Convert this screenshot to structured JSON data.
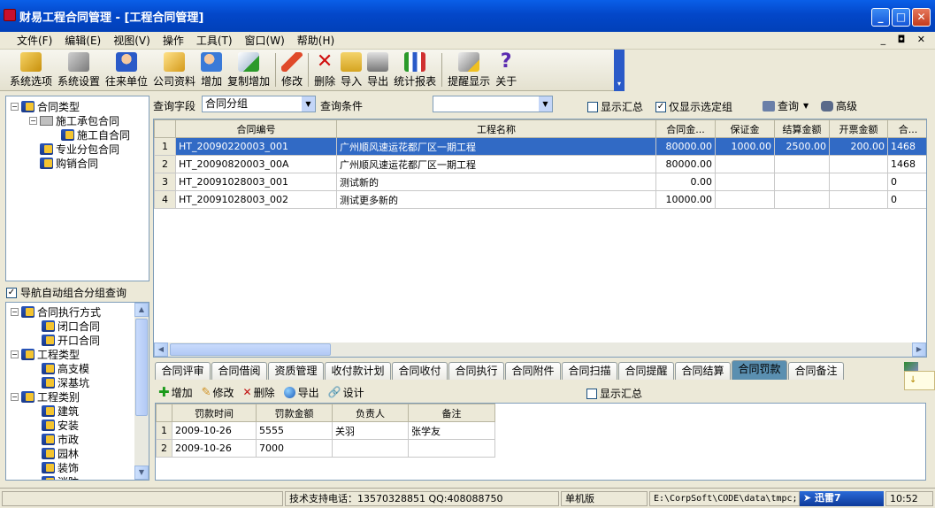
{
  "window": {
    "title": "财易工程合同管理 - [工程合同管理]"
  },
  "menu": [
    "文件(F)",
    "编辑(E)",
    "视图(V)",
    "操作",
    "工具(T)",
    "窗口(W)",
    "帮助(H)"
  ],
  "toolbar": {
    "items": [
      {
        "label": "系统选项",
        "icon": "gold-wrench-icon"
      },
      {
        "label": "系统设置",
        "icon": "tools-icon"
      },
      {
        "label": "往来单位",
        "icon": "user-icon"
      },
      {
        "label": "公司资料",
        "icon": "card-icon"
      },
      {
        "label": "增加",
        "icon": "add-user-icon"
      },
      {
        "label": "复制增加",
        "icon": "copy-add-icon"
      },
      {
        "label": "修改",
        "icon": "pencil-icon"
      },
      {
        "label": "删除",
        "icon": "delete-x-icon"
      },
      {
        "label": "导入",
        "icon": "import-icon"
      },
      {
        "label": "导出",
        "icon": "export-icon"
      },
      {
        "label": "统计报表",
        "icon": "bar-chart-icon"
      },
      {
        "label": "提醒显示",
        "icon": "reminder-icon"
      },
      {
        "label": "关于",
        "icon": "question-icon"
      }
    ]
  },
  "tree1": [
    {
      "label": "合同类型",
      "level": 0,
      "exp": "−"
    },
    {
      "label": "施工承包合同",
      "level": 1,
      "exp": "−"
    },
    {
      "label": "施工自合同",
      "level": 2,
      "exp": ""
    },
    {
      "label": "专业分包合同",
      "level": 1,
      "exp": ""
    },
    {
      "label": "购销合同",
      "level": 1,
      "exp": ""
    }
  ],
  "nav_auto_group": {
    "label": "导航自动组合分组查询",
    "checked": true
  },
  "tree2": [
    {
      "label": "合同执行方式",
      "level": 0,
      "exp": "−"
    },
    {
      "label": "闭口合同",
      "level": 1
    },
    {
      "label": "开口合同",
      "level": 1
    },
    {
      "label": "工程类型",
      "level": 0,
      "exp": "−"
    },
    {
      "label": "高支模",
      "level": 1
    },
    {
      "label": "深基坑",
      "level": 1
    },
    {
      "label": "工程类别",
      "level": 0,
      "exp": "−"
    },
    {
      "label": "建筑",
      "level": 1
    },
    {
      "label": "安装",
      "level": 1
    },
    {
      "label": "市政",
      "level": 1
    },
    {
      "label": "园林",
      "level": 1
    },
    {
      "label": "装饰",
      "level": 1
    },
    {
      "label": "消防",
      "level": 1
    }
  ],
  "query": {
    "field_label": "查询字段",
    "field_value": "合同分组",
    "cond_label": "查询条件",
    "cond_value": "",
    "show_summary": "显示汇总",
    "only_selected": "仅显示选定组",
    "query_btn": "查询",
    "advanced_btn": "高级"
  },
  "main_table": {
    "headers": [
      "合同编号",
      "工程名称",
      "合同金...",
      "保证金",
      "结算金额",
      "开票金额",
      "合..."
    ],
    "rows": [
      {
        "n": "1",
        "no": "HT_20090220003_001",
        "name": "广州顺风速运花都厂区一期工程",
        "amt": "80000.00",
        "dep": "1000.00",
        "set": "2500.00",
        "inv": "200.00",
        "x": "1468"
      },
      {
        "n": "2",
        "no": "HT_20090820003_00A",
        "name": "广州顺风速运花都厂区一期工程",
        "amt": "80000.00",
        "dep": "",
        "set": "",
        "inv": "",
        "x": "1468"
      },
      {
        "n": "3",
        "no": "HT_20091028003_001",
        "name": "测试新的",
        "amt": "0.00",
        "dep": "",
        "set": "",
        "inv": "",
        "x": "0"
      },
      {
        "n": "4",
        "no": "HT_20091028003_002",
        "name": "测试更多新的",
        "amt": "10000.00",
        "dep": "",
        "set": "",
        "inv": "",
        "x": "0"
      }
    ]
  },
  "tabs": [
    "合同评审",
    "合同借阅",
    "资质管理",
    "收付款计划",
    "合同收付",
    "合同执行",
    "合同附件",
    "合同扫描",
    "合同提醒",
    "合同结算",
    "合同罚款",
    "合同备注"
  ],
  "active_tab": "合同罚款",
  "sub_toolbar": {
    "add": "增加",
    "edit": "修改",
    "delete": "删除",
    "export": "导出",
    "design": "设计",
    "show_summary": "显示汇总"
  },
  "penalty_table": {
    "headers": [
      "罚款时间",
      "罚款金额",
      "负责人",
      "备注"
    ],
    "rows": [
      {
        "n": "1",
        "date": "2009-10-26",
        "amt": "5555",
        "person": "关羽",
        "note": "张学友"
      },
      {
        "n": "2",
        "date": "2009-10-26",
        "amt": "7000",
        "person": "",
        "note": ""
      }
    ]
  },
  "status": {
    "support": "技术支持电话：13570328851 QQ:408088750",
    "edition": "单机版",
    "path": "E:\\CorpSoft\\CODE\\data\\tmpc;",
    "xunlei": "迅雷7",
    "time": "10:52"
  },
  "colors": {
    "title": "#0347c9",
    "selection": "#316ac5",
    "active_tab": "#5a8fb0"
  }
}
